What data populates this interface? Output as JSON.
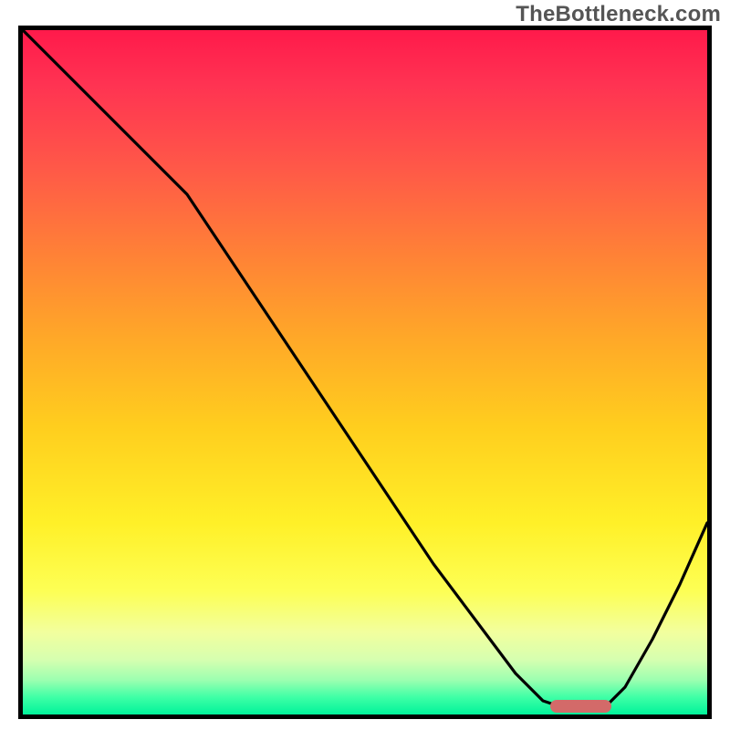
{
  "watermark": "TheBottleneck.com",
  "colors": {
    "frame": "#000000",
    "curve": "#000000",
    "marker": "#d36a69",
    "gradient_top": "#ff1a4b",
    "gradient_bottom": "#00f39a"
  },
  "chart_data": {
    "type": "line",
    "title": "",
    "xlabel": "",
    "ylabel": "",
    "xlim": [
      0,
      100
    ],
    "ylim": [
      0,
      100
    ],
    "grid": false,
    "legend": "none",
    "series": [
      {
        "name": "bottleneck-curve",
        "x": [
          0,
          6,
          12,
          18,
          24,
          30,
          36,
          42,
          48,
          54,
          60,
          66,
          72,
          76,
          79,
          82,
          85,
          88,
          92,
          96,
          100
        ],
        "y": [
          100,
          94,
          88,
          82,
          76,
          67,
          58,
          49,
          40,
          31,
          22,
          14,
          6,
          2,
          1,
          0.8,
          1,
          4,
          11,
          19,
          28
        ]
      }
    ],
    "marker": {
      "name": "optimal-range",
      "x_start": 77,
      "x_end": 86,
      "y": 1.2
    }
  }
}
